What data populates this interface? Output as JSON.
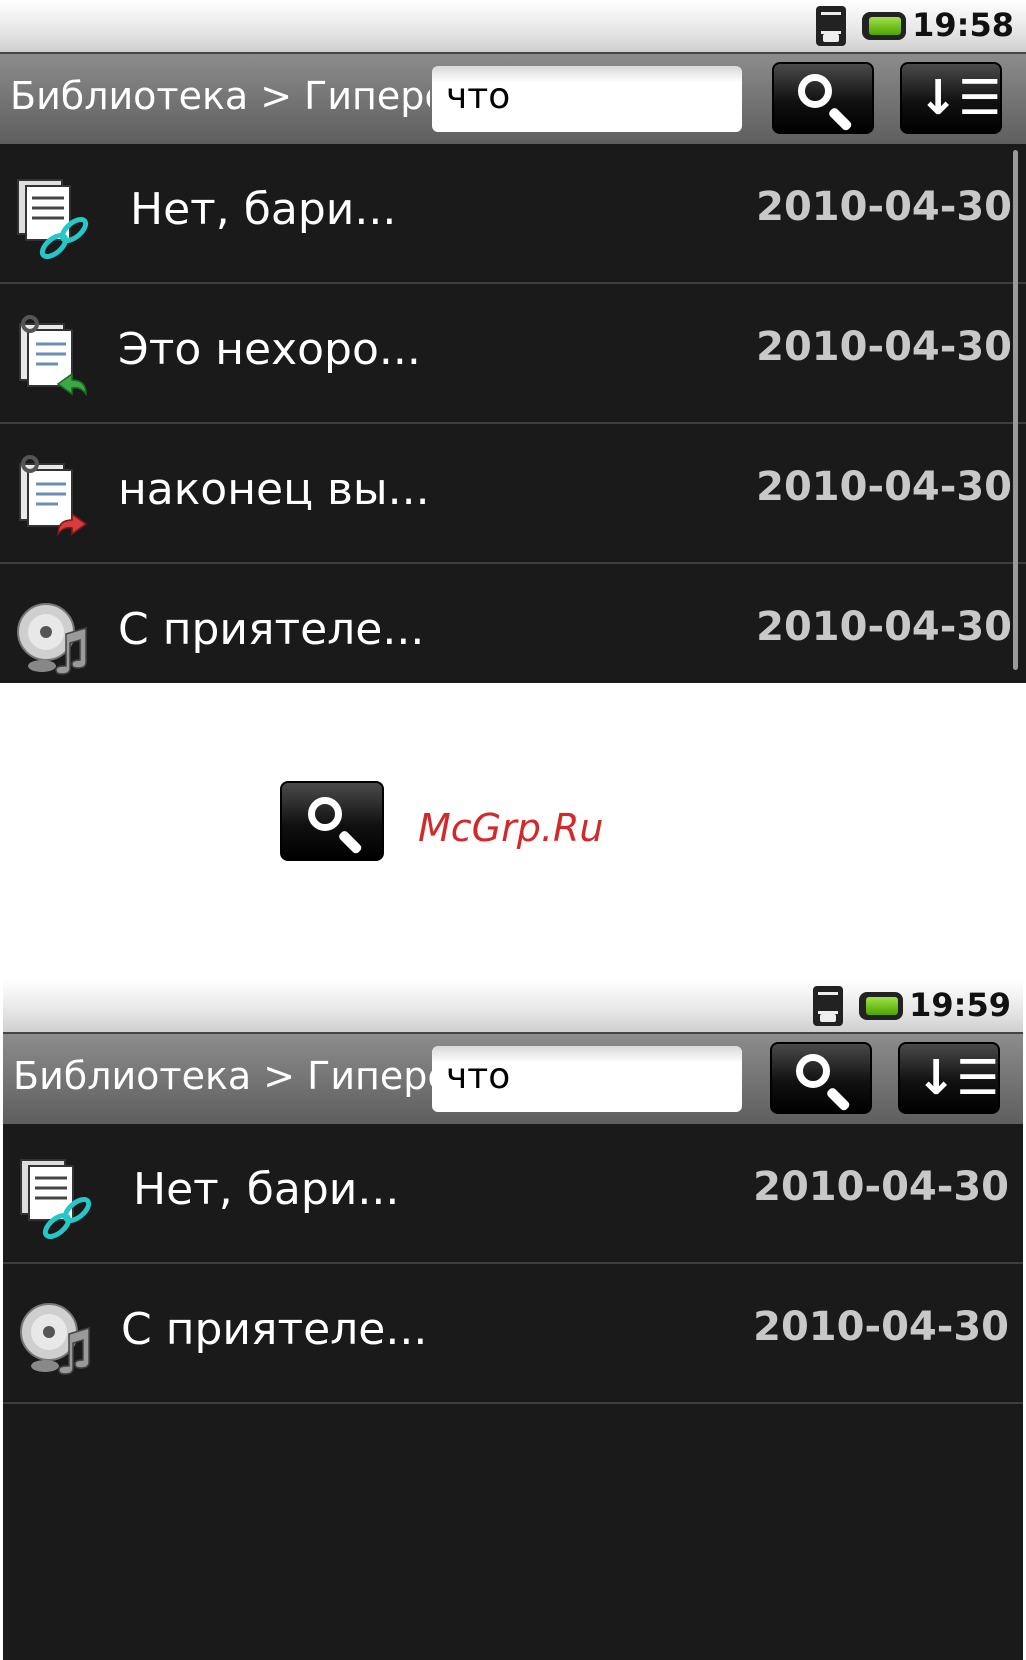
{
  "screens": [
    {
      "status_time": "19:58",
      "breadcrumb": "Библиотека > Гиперс",
      "search_value": "что",
      "rows": [
        {
          "title": "Нет, бари...",
          "date": "2010-04-30",
          "icon": "document-link-icon"
        },
        {
          "title": "Это нехоро...",
          "date": "2010-04-30",
          "icon": "document-reply-icon"
        },
        {
          "title": "наконец вы...",
          "date": "2010-04-30",
          "icon": "document-forward-icon"
        },
        {
          "title": "С приятеле...",
          "date": "2010-04-30",
          "icon": "audio-cd-icon"
        }
      ]
    },
    {
      "status_time": "19:59",
      "breadcrumb": "Библиотека > Гиперс",
      "search_value": "что",
      "rows": [
        {
          "title": "Нет, бари...",
          "date": "2010-04-30",
          "icon": "document-link-icon"
        },
        {
          "title": "С приятеле...",
          "date": "2010-04-30",
          "icon": "audio-cd-icon"
        }
      ]
    }
  ],
  "watermark": "McGrp.Ru",
  "colors": {
    "list_background": "#1a1a1a",
    "toolbar_gradient_top": "#8c8c8c",
    "battery_green": "#6cc414",
    "watermark_red": "#d12a2a",
    "link_teal": "#25c7c7"
  }
}
